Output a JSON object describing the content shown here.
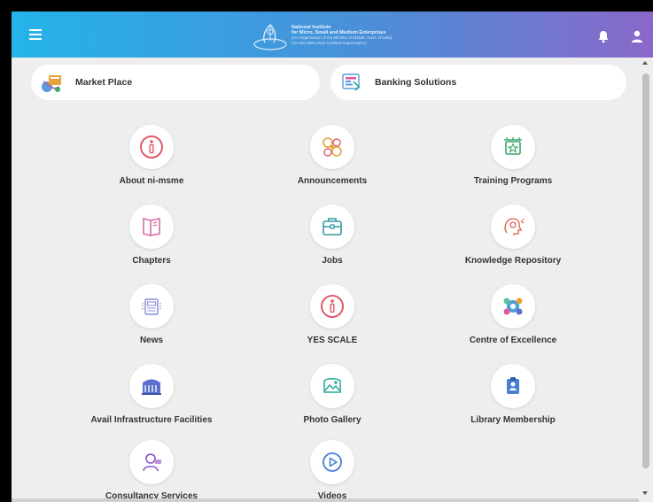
{
  "header": {
    "brand_lines": [
      "National Institute",
      "for Micro, Small and Medium Enterprises",
      "(An Organisation of the Ministry of MSME, Govt. of India)",
      "(An ISO 9001:2015 Certified Organisation)"
    ],
    "colors": {
      "gradient_start": "#24b4e9",
      "gradient_end": "#8a68c9"
    },
    "icons": [
      "menu-icon",
      "bell-icon",
      "user-icon"
    ]
  },
  "pills": [
    {
      "label": "Market Place",
      "icon": "market-place-icon"
    },
    {
      "label": "Banking Solutions",
      "icon": "banking-solutions-icon"
    }
  ],
  "tiles": [
    {
      "label": "About ni-msme",
      "icon": "info-icon",
      "color": "#e05a6b"
    },
    {
      "label": "Announcements",
      "icon": "announcements-icon",
      "color": "#e8a23a"
    },
    {
      "label": "Training Programs",
      "icon": "training-icon",
      "color": "#3aa86b"
    },
    {
      "label": "Chapters",
      "icon": "chapters-icon",
      "color": "#d86aa8"
    },
    {
      "label": "Jobs",
      "icon": "briefcase-icon",
      "color": "#2f9aa3"
    },
    {
      "label": "Knowledge Repository",
      "icon": "knowledge-icon",
      "color": "#e07a5a"
    },
    {
      "label": "News",
      "icon": "news-icon",
      "color": "#8a8fd8"
    },
    {
      "label": "YES SCALE",
      "icon": "info-icon",
      "color": "#e05a6b"
    },
    {
      "label": "Centre of Excellence",
      "icon": "excellence-icon",
      "color": "#4aa0d8"
    },
    {
      "label": "Avail Infrastructure Facilities",
      "icon": "infrastructure-icon",
      "color": "#5a6fd0"
    },
    {
      "label": "Photo Gallery",
      "icon": "gallery-icon",
      "color": "#2fa89a"
    },
    {
      "label": "Library Membership",
      "icon": "library-icon",
      "color": "#4a7fd0"
    },
    {
      "label": "Consultancy Services",
      "icon": "consultancy-icon",
      "color": "#8a5ac8"
    },
    {
      "label": "Videos",
      "icon": "video-icon",
      "color": "#4a7fd0"
    }
  ]
}
